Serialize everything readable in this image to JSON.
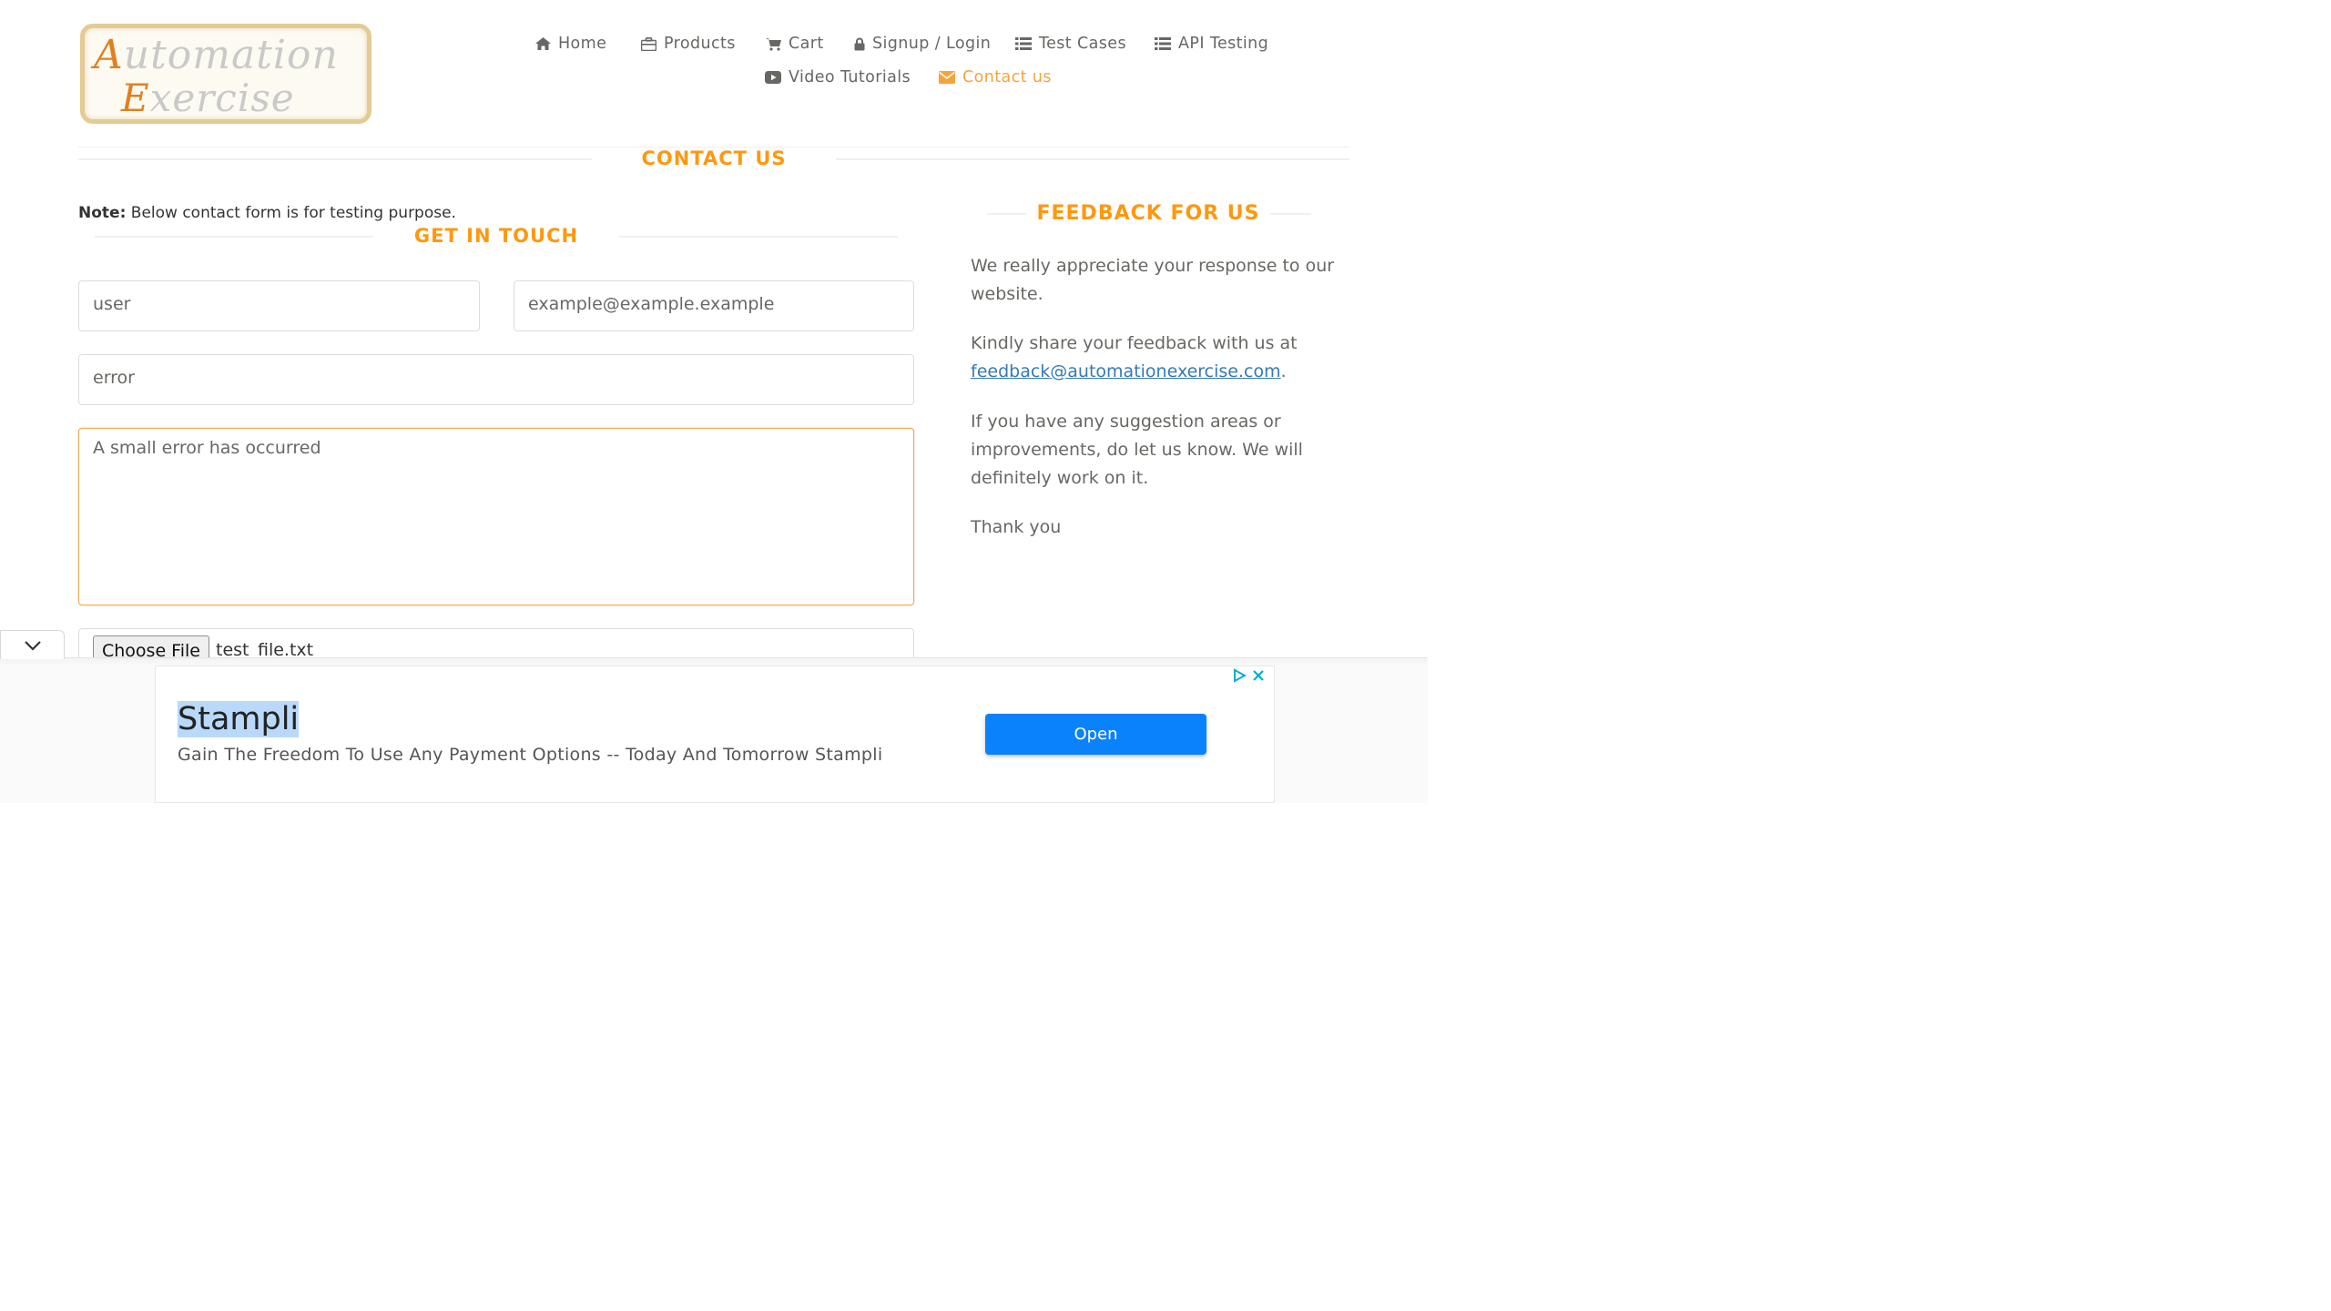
{
  "logo": {
    "line1_cap": "A",
    "line1_rest": "utomation",
    "line2_cap": "E",
    "line2_rest": "xercise"
  },
  "nav": {
    "home": "Home",
    "products": "Products",
    "cart": "Cart",
    "signup_login": "Signup / Login",
    "test_cases": "Test Cases",
    "api_testing": "API Testing",
    "video_tutorials": "Video Tutorials",
    "contact_us": "Contact us"
  },
  "page_title": "CONTACT US",
  "note": {
    "label": "Note:",
    "text": "Below contact form is for testing purpose."
  },
  "form": {
    "title": "GET IN TOUCH",
    "name_value": "user",
    "email_value": "example@example.example",
    "subject_value": "error",
    "message_value": "A small error has occurred",
    "choose_file_label": "Choose File",
    "file_name": "test_file.txt"
  },
  "feedback": {
    "title": "FEEDBACK FOR US",
    "p1": "We really appreciate your response to our website.",
    "p2_prefix": "Kindly share your feedback with us at",
    "p2_email": "feedback@automationexercise.com",
    "p2_suffix": ".",
    "p3": "If you have any suggestion areas or improvements, do let us know. We will definitely work on it.",
    "p4": "Thank you"
  },
  "ad": {
    "title": "Stampli",
    "description": "Gain The Freedom To Use Any Payment Options -- Today And Tomorrow Stampli",
    "open_label": "Open"
  },
  "colors": {
    "accent": "#fe980f",
    "link": "#337ab7",
    "ad_button": "#0a82fb"
  }
}
